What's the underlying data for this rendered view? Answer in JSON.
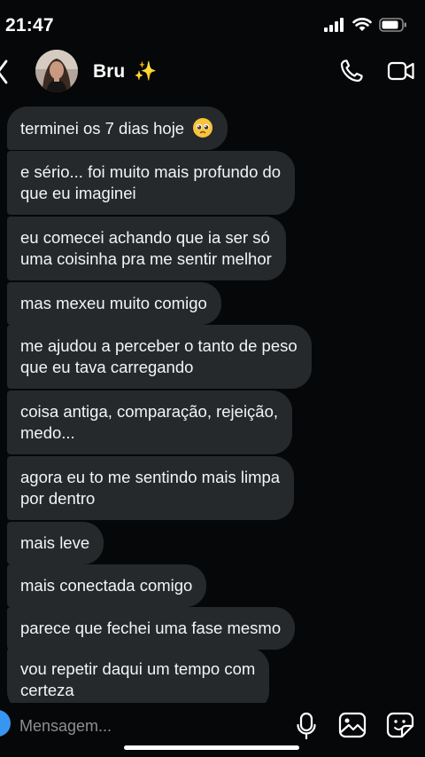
{
  "status_bar": {
    "time": "21:47"
  },
  "header": {
    "contact_name": "Bru",
    "name_emoji": "✨"
  },
  "messages": [
    {
      "text": "terminei os 7 dias hoje",
      "emoji": "pleading-face"
    },
    {
      "line1": "e sério... foi muito mais profundo do",
      "line2": "que eu imaginei"
    },
    {
      "line1": "eu comecei achando que ia ser só",
      "line2": "uma coisinha pra me sentir melhor"
    },
    {
      "text": "mas mexeu muito comigo"
    },
    {
      "line1": "me ajudou a perceber o tanto de peso",
      "line2": "que eu tava carregando"
    },
    {
      "line1": "coisa antiga, comparação, rejeição,",
      "line2": "medo..."
    },
    {
      "line1": "agora eu to me sentindo mais limpa",
      "line2": "por dentro"
    },
    {
      "text": "mais leve"
    },
    {
      "text": "mais conectada comigo"
    },
    {
      "text": "parece que fechei uma fase mesmo"
    },
    {
      "line1": "vou repetir daqui um tempo com",
      "line2": "certeza"
    }
  ],
  "input": {
    "placeholder": "Mensagem..."
  },
  "icons": {
    "back": "chevron-left-icon",
    "phone": "phone-icon",
    "video": "video-camera-icon",
    "microphone": "microphone-icon",
    "gallery": "image-icon",
    "sticker": "sticker-icon"
  },
  "colors": {
    "background": "#060708",
    "bubble": "#26292c",
    "text": "#f4f4f4",
    "placeholder": "#8c8e91",
    "accent": "#3797f0"
  }
}
